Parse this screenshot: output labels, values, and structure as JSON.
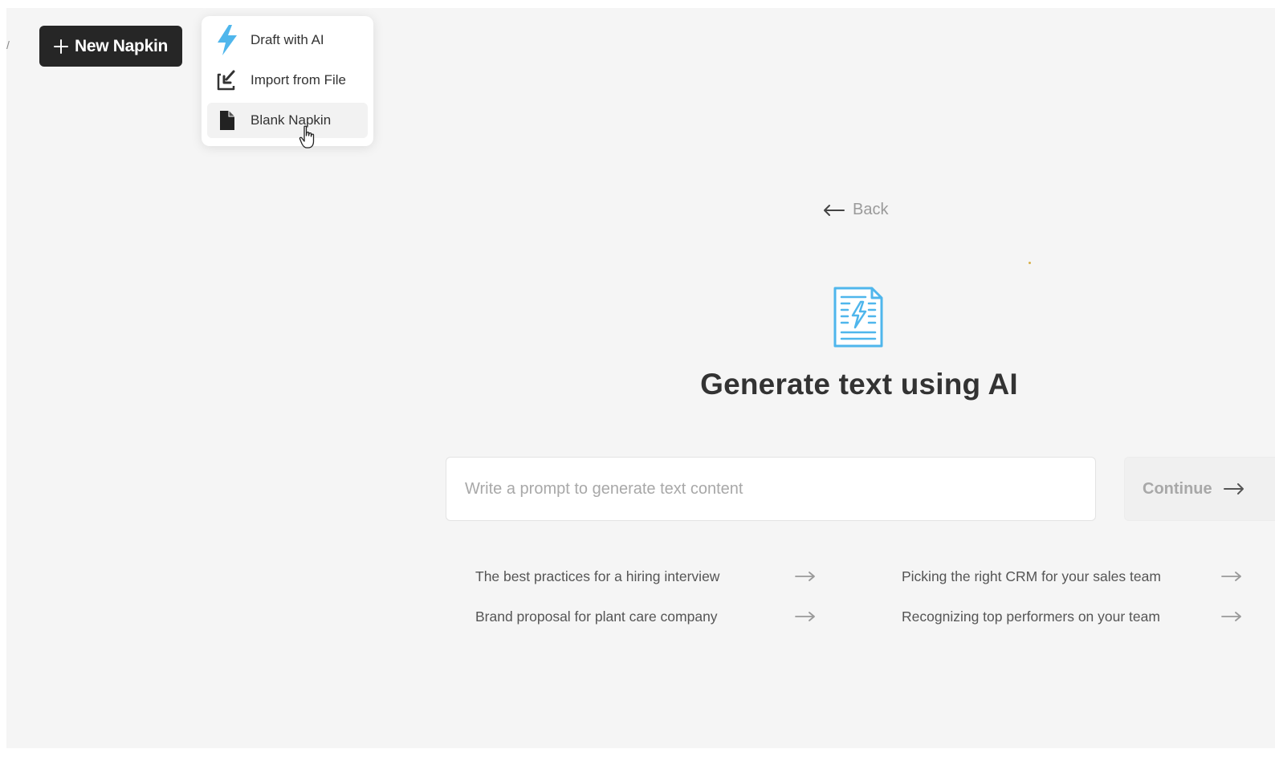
{
  "toolbar": {
    "edge_mark": "/",
    "new_napkin_label": "New Napkin"
  },
  "new_menu": {
    "items": [
      {
        "label": "Draft with AI",
        "icon": "lightning-icon"
      },
      {
        "label": "Import from File",
        "icon": "import-file-icon"
      },
      {
        "label": "Blank Napkin",
        "icon": "blank-document-icon"
      }
    ]
  },
  "main": {
    "back_label": "Back",
    "icon": "ai-document-icon",
    "heading": "Generate text using AI",
    "prompt_placeholder": "Write a prompt to generate text content",
    "continue_label": "Continue",
    "suggestions": [
      "The best practices for a hiring interview",
      "Picking the right CRM for your sales team",
      "Brand proposal for plant care company",
      "Recognizing top performers on your team"
    ]
  },
  "colors": {
    "button_dark": "#262626",
    "accent_blue": "#4fb6ec",
    "background": "#f5f5f5"
  }
}
